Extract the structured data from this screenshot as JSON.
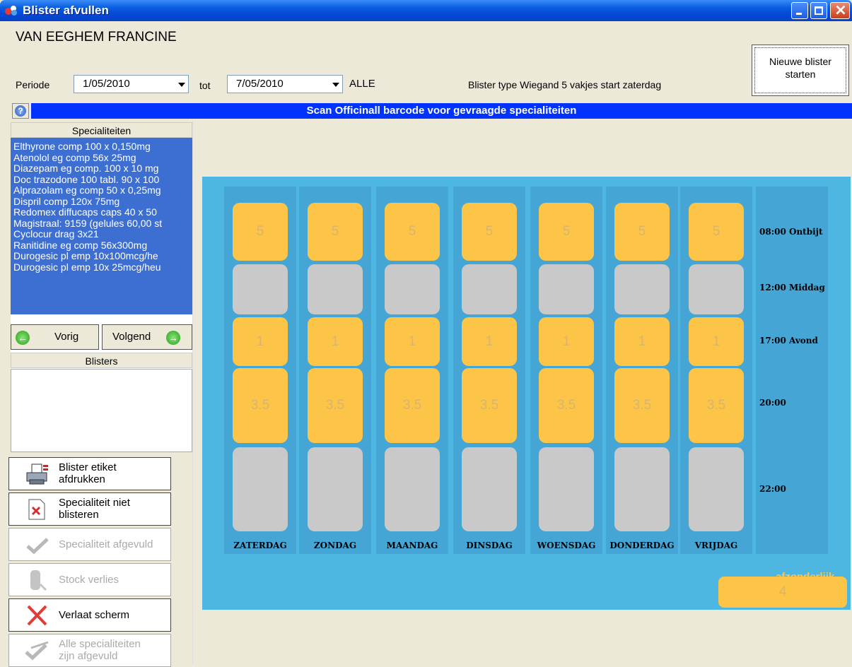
{
  "window": {
    "title": "Blister afvullen"
  },
  "header": {
    "patient_name": "VAN EEGHEM FRANCINE",
    "periode_label": "Periode",
    "date_from": "1/05/2010",
    "tot_label": "tot",
    "date_to": "7/05/2010",
    "alle_label": "ALLE",
    "blister_type": "Blister type Wiegand 5 vakjes start zaterdag",
    "new_blister_line1": "Nieuwe blister",
    "new_blister_line2": "starten"
  },
  "scan_bar": {
    "text": "Scan Officinall barcode voor gevraagde specialiteiten"
  },
  "left": {
    "specialiteiten_header": "Specialiteiten",
    "specialiteiten": [
      "Elthyrone comp 100 x 0,150mg",
      "Atenolol eg comp  56x 25mg",
      "Diazepam eg comp. 100 x 10 mg",
      "Doc trazodone 100 tabl. 90 x 100",
      "Alprazolam eg comp 50 x 0,25mg",
      "Dispril comp 120x 75mg",
      "Redomex diffucaps caps  40 x 50",
      "Magistraal: 9159 (gelules 60,00 st",
      "Cyclocur drag 3x21",
      "Ranitidine eg comp  56x300mg",
      "Durogesic pl emp 10x100mcg/he",
      "Durogesic pl emp 10x 25mcg/heu"
    ],
    "vorig_label": "Vorig",
    "volgend_label": "Volgend",
    "blisters_header": "Blisters"
  },
  "actions": {
    "etiket_line1": "Blister etiket",
    "etiket_line2": "afdrukken",
    "niet_blisteren_line1": "Specialiteit niet",
    "niet_blisteren_line2": "blisteren",
    "afgevuld": "Specialiteit afgevuld",
    "stock_verlies": "Stock verlies",
    "verlaat": "Verlaat scherm",
    "alle_line1": "Alle specialiteiten",
    "alle_line2": "zijn afgevuld"
  },
  "blister": {
    "days": [
      "ZATERDAG",
      "ZONDAG",
      "MAANDAG",
      "DINSDAG",
      "WOENSDAG",
      "DONDERDAG",
      "VRIJDAG"
    ],
    "times": [
      "08:00 Ontbijt",
      "12:00 Middag",
      "17:00 Avond",
      "20:00",
      "22:00"
    ],
    "slot_values": [
      "5",
      "",
      "1",
      "3.5",
      ""
    ],
    "afzonderlijk_label": "afzonderlijk",
    "afzonderlijk_value": "4",
    "colors": {
      "filled": "#FCC548",
      "empty": "#C9C9C9",
      "board": "#4DB7E2"
    }
  }
}
